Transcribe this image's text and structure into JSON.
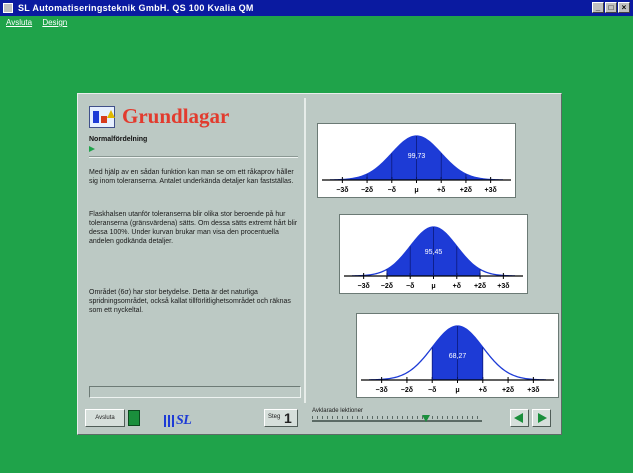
{
  "window": {
    "title": "SL Automatiseringsteknik GmbH.  QS 100 Kvalia QM"
  },
  "menu": [
    "Avsluta",
    "Design"
  ],
  "content": {
    "title": "Grundlagar",
    "subtitle": "Normalfördelning",
    "paragraphs": [
      "Med hjälp av en sådan funktion kan man se om ett råkaprov håller sig inom toleranserna. Antalet underkända detaljer kan fastställas.",
      "Flaskhalsen utanför toleranserna blir olika stor beroende på hur toleranserna (gränsvärdena) sätts. Om dessa sätts extremt hårt blir dessa 100%. Under kurvan brukar man visa den procentuella andelen godkända detaljer.",
      "Området (6σ) har stor betydelse. Detta är det naturliga spridningsområdet, också kallat tillförlitlighetsområdet och räknas som ett nyckeltal."
    ]
  },
  "charts": [
    {
      "label": "99,73",
      "axis": [
        "−3δ",
        "−2δ",
        "−δ",
        "μ",
        "+δ",
        "+2δ",
        "+3δ"
      ],
      "shade_sigma": 3
    },
    {
      "label": "95,45",
      "axis": [
        "−3δ",
        "−2δ",
        "−δ",
        "μ",
        "+δ",
        "+2δ",
        "+3δ"
      ],
      "shade_sigma": 2
    },
    {
      "label": "68,27",
      "axis": [
        "−3δ",
        "−2δ",
        "−δ",
        "μ",
        "+δ",
        "+2δ",
        "+3δ"
      ],
      "shade_sigma": 1
    }
  ],
  "toolbar": {
    "exit_label": "Avsluta",
    "step_label": "Steg",
    "step_number": "1",
    "slider_label": "Avklarade lektioner",
    "slider_value": 0.67,
    "logo_text": "SL"
  },
  "colors": {
    "background": "#1fa34a",
    "panel": "#bcc9c4",
    "curve_fill": "#1d3bd6",
    "title": "#e23b2e"
  }
}
